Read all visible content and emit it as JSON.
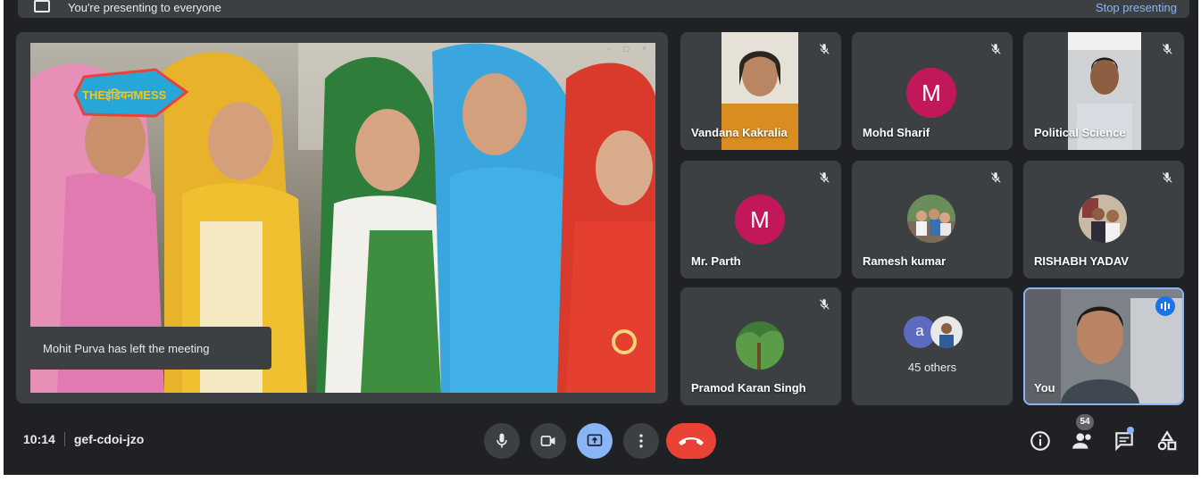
{
  "banner": {
    "text": "You're presenting to everyone",
    "stop_label": "Stop presenting"
  },
  "presentation": {
    "logo_text": "THEइंडियनMESS",
    "toast": "Mohit Purva has left the meeting"
  },
  "participants": [
    {
      "name": "Vandana Kakralia",
      "muted": true,
      "avatar": "camera-video"
    },
    {
      "name": "Mohd Sharif",
      "muted": true,
      "avatar": "letter",
      "letter": "M",
      "color": "#c2185b"
    },
    {
      "name": "Political Science",
      "muted": true,
      "avatar": "camera-video"
    },
    {
      "name": "Mr. Parth",
      "muted": true,
      "avatar": "letter",
      "letter": "M",
      "color": "#c2185b"
    },
    {
      "name": "Ramesh kumar",
      "muted": true,
      "avatar": "photo"
    },
    {
      "name": "RISHABH YADAV",
      "muted": true,
      "avatar": "photo"
    },
    {
      "name": "Pramod Karan Singh",
      "muted": true,
      "avatar": "photo"
    },
    {
      "name": "",
      "others_label": "45 others",
      "others_letter": "a",
      "others_letter_color": "#5c6bc0"
    },
    {
      "name": "You",
      "speaking": true,
      "avatar": "camera-video"
    }
  ],
  "bottom_bar": {
    "time": "10:14",
    "meeting_code": "gef-cdoi-jzo",
    "people_count": "54"
  },
  "colors": {
    "background": "#202124",
    "tile": "#3c4043",
    "accent_blue": "#8ab4f8",
    "leave_red": "#ea4335",
    "avatar_magenta": "#c2185b"
  }
}
